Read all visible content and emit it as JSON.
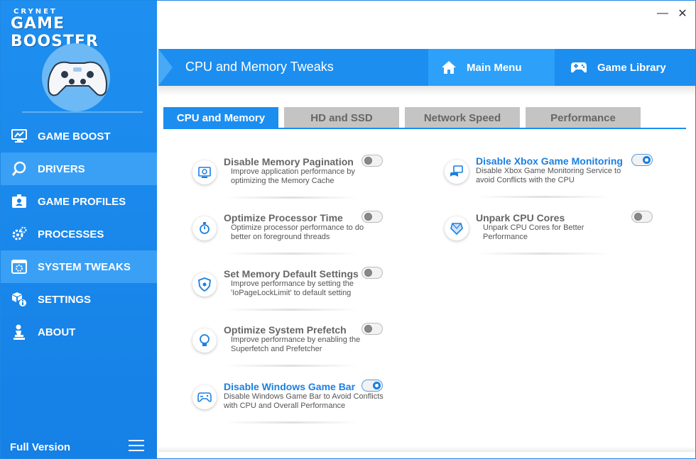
{
  "brand": {
    "top": "CRYNET",
    "main": "GAME BOOSTER"
  },
  "sidebar": {
    "items": [
      {
        "label": "GAME BOOST",
        "icon": "monitor-chart-icon",
        "active": false
      },
      {
        "label": "DRIVERS",
        "icon": "search-icon",
        "active": true
      },
      {
        "label": "GAME PROFILES",
        "icon": "profile-card-icon",
        "active": false
      },
      {
        "label": "PROCESSES",
        "icon": "gears-icon",
        "active": false
      },
      {
        "label": "SYSTEM TWEAKS",
        "icon": "system-window-icon",
        "active": true
      },
      {
        "label": "SETTINGS",
        "icon": "settings-cubes-icon",
        "active": false
      },
      {
        "label": "ABOUT",
        "icon": "person-info-icon",
        "active": false
      }
    ],
    "footer": "Full Version"
  },
  "window": {
    "minimize": "—",
    "close": "✕"
  },
  "header": {
    "title": "CPU and Memory Tweaks",
    "main_menu": "Main Menu",
    "game_library": "Game Library"
  },
  "tabs": [
    {
      "label": "CPU and Memory",
      "active": true
    },
    {
      "label": "HD and SSD",
      "active": false
    },
    {
      "label": "Network Speed",
      "active": false
    },
    {
      "label": "Performance",
      "active": false
    }
  ],
  "tweaks": [
    {
      "title": "Disable Memory Pagination",
      "desc": "Improve application performance by optimizing the Memory Cache",
      "enabled": false,
      "icon": "memory-chip-icon"
    },
    {
      "title": "Optimize Processor Time",
      "desc": "Optimize processor performance to do better on foreground threads",
      "enabled": false,
      "icon": "stopwatch-icon"
    },
    {
      "title": "Set Memory Default Settings",
      "desc": "Improve performance by setting the 'IoPageLockLimit' to default setting",
      "enabled": false,
      "icon": "shield-icon"
    },
    {
      "title": "Optimize System Prefetch",
      "desc": "Improve performance by enabling the Superfetch and Prefetcher",
      "enabled": false,
      "icon": "lightbulb-icon"
    },
    {
      "title": "Disable Windows Game Bar",
      "desc": "Disable Windows Game Bar to Avoid Conflicts with CPU and Overall Performance",
      "enabled": true,
      "icon": "gamepad-icon"
    },
    {
      "title": "Disable Xbox Game Monitoring",
      "desc": "Disable Xbox Game Monitoring Service to avoid Conflicts with the CPU",
      "enabled": true,
      "icon": "xbox-monitor-icon"
    },
    {
      "title": "Unpark CPU Cores",
      "desc": "Unpark CPU Cores for Better Performance",
      "enabled": false,
      "icon": "cpu-gem-icon"
    }
  ],
  "colors": {
    "accent": "#1b8ef0",
    "sidebar": "#1580e6",
    "active_title": "#1b7fe0"
  }
}
